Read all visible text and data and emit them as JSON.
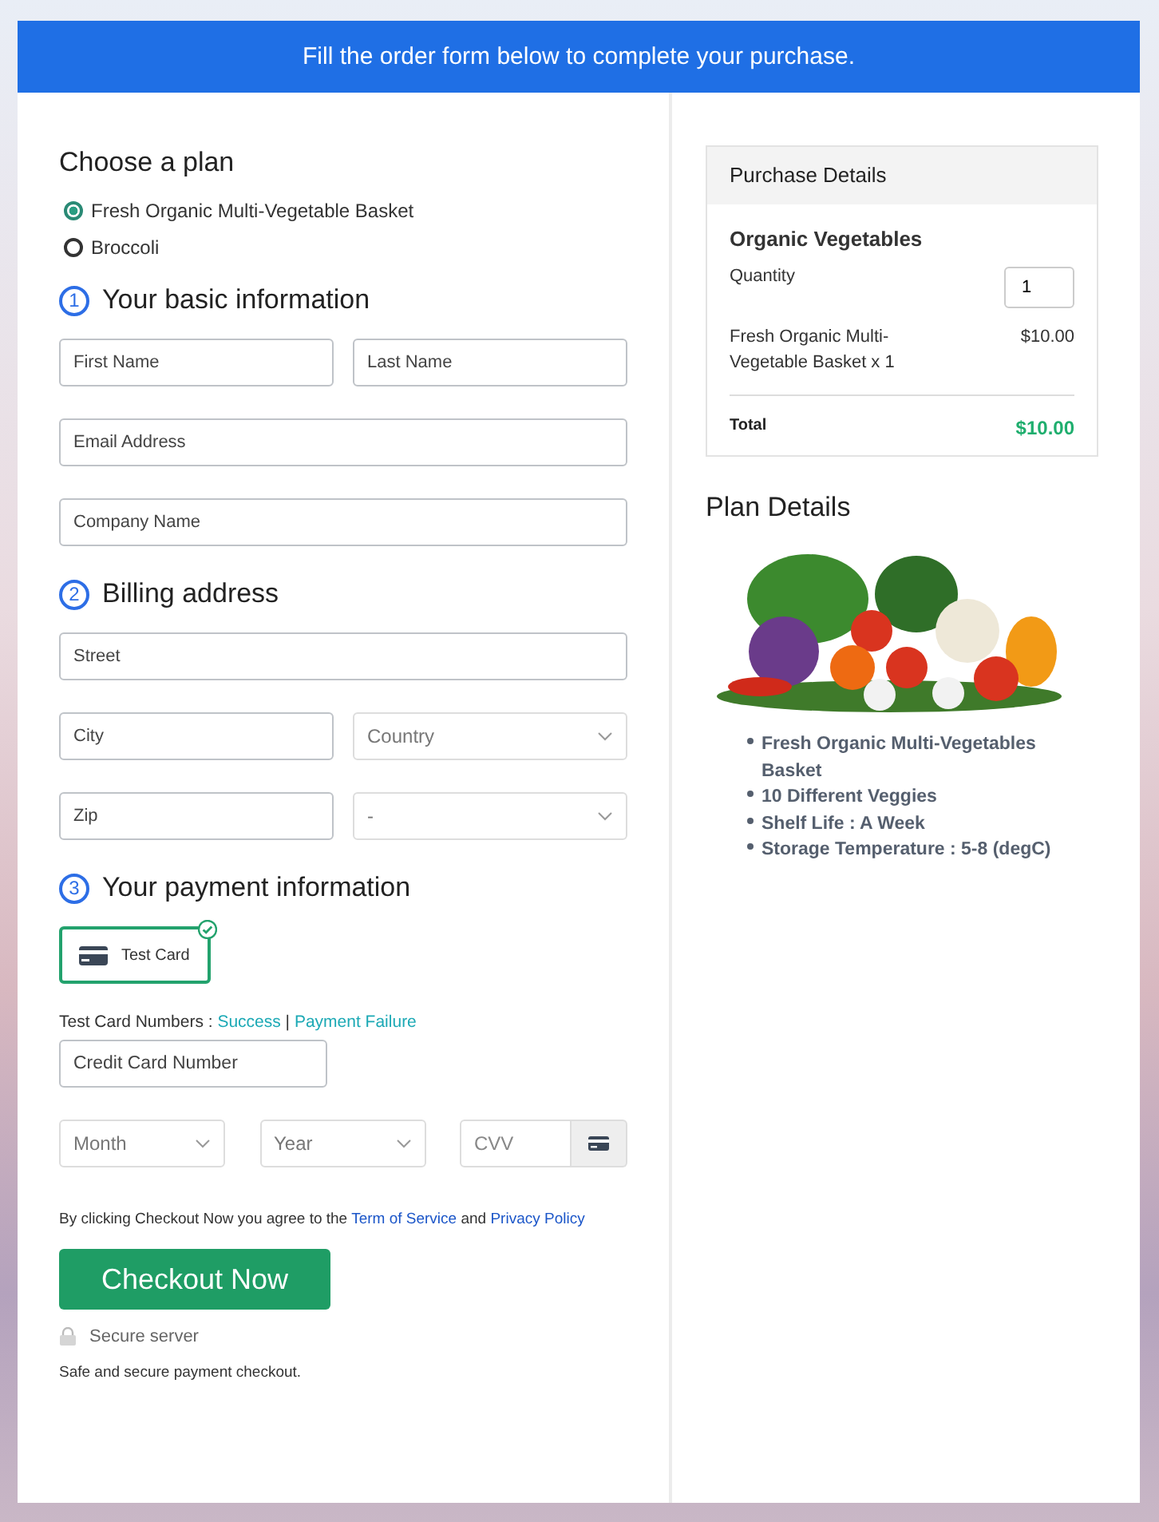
{
  "banner": "Fill the order form below to complete your purchase.",
  "plan": {
    "title": "Choose a plan",
    "options": [
      {
        "label": "Fresh Organic Multi-Vegetable Basket",
        "selected": true
      },
      {
        "label": "Broccoli",
        "selected": false
      }
    ]
  },
  "sections": [
    {
      "number": "1",
      "title": "Your basic information",
      "rows": [
        [
          {
            "kind": "input",
            "placeholder": "First Name"
          },
          {
            "kind": "input",
            "placeholder": "Last Name"
          }
        ],
        [
          {
            "kind": "input",
            "placeholder": "Email Address"
          }
        ],
        [
          {
            "kind": "input",
            "placeholder": "Company Name"
          }
        ]
      ]
    },
    {
      "number": "2",
      "title": "Billing address",
      "rows": [
        [
          {
            "kind": "input",
            "placeholder": "Street"
          }
        ],
        [
          {
            "kind": "input",
            "placeholder": "City"
          },
          {
            "kind": "select",
            "value": "Country"
          }
        ],
        [
          {
            "kind": "input",
            "placeholder": "Zip"
          },
          {
            "kind": "select",
            "value": "-"
          }
        ]
      ]
    }
  ],
  "payment": {
    "number": "3",
    "title": "Your payment information",
    "methods": [
      {
        "label": "Test Card",
        "selected": true
      }
    ],
    "test_numbers": {
      "label": "Test Card Numbers :",
      "links": [
        "Success",
        "Payment Failure"
      ],
      "separator": "|"
    },
    "card_number": {
      "placeholder": "Credit Card Number"
    },
    "month": {
      "value": "Month"
    },
    "year": {
      "value": "Year"
    },
    "cvv": {
      "placeholder": "CVV"
    },
    "terms": {
      "text": "By clicking Checkout Now you agree to the",
      "joiner": "and",
      "links": [
        "Term of Service",
        "Privacy Policy"
      ]
    },
    "checkout_button": "Checkout Now",
    "secure_label": "Secure server",
    "note": "Safe and secure payment checkout."
  },
  "purchase": {
    "title": "Purchase Details",
    "product": "Organic Vegetables",
    "quantity_label": "Quantity",
    "quantity": "1",
    "line_item": {
      "name": "Fresh Organic Multi-Vegetable Basket x 1",
      "price": "$10.00"
    },
    "total_label": "Total",
    "total": "$10.00"
  },
  "plan_details": {
    "title": "Plan Details",
    "features": [
      "Fresh Organic Multi-Vegetables Basket",
      "10 Different Veggies",
      "Shelf Life : A Week",
      "Storage Temperature : 5-8 (degC)"
    ]
  }
}
